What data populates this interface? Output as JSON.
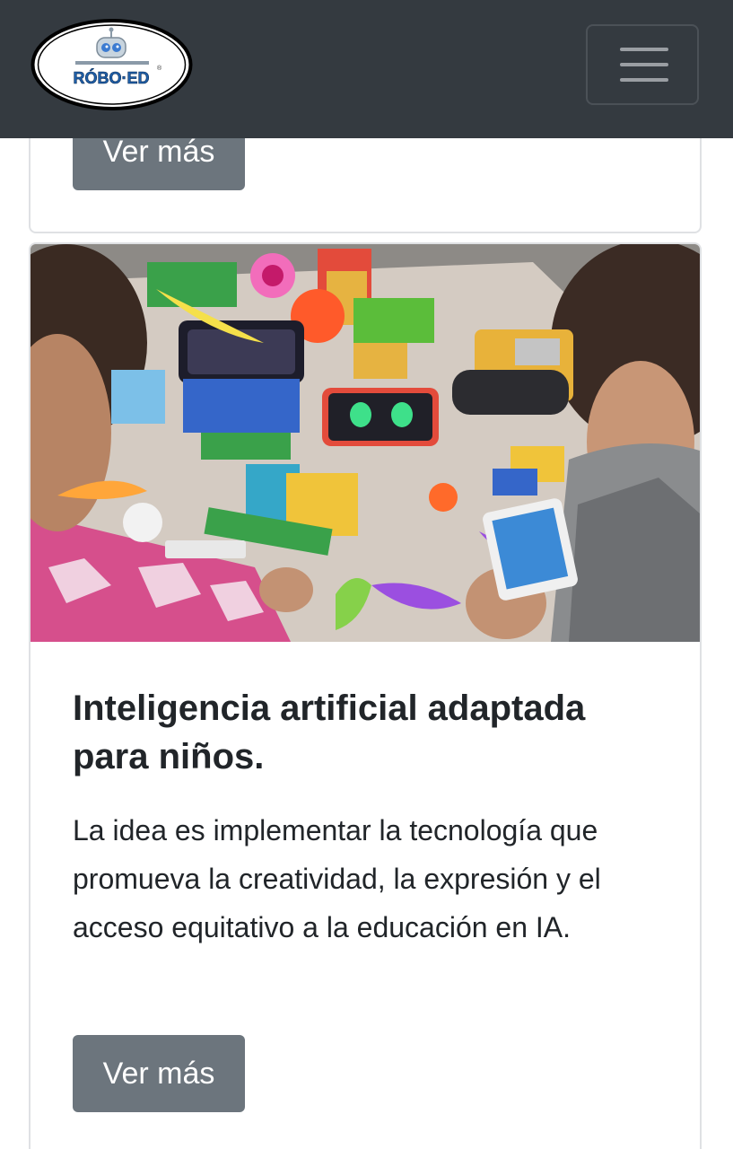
{
  "navbar": {
    "logo_text": "RÓBO·ED",
    "logo_mark": "®",
    "menu_icon": "hamburger-menu-icon"
  },
  "previous_card": {
    "button_label": "Ver más"
  },
  "card": {
    "image_description_icon": "photo-kids-building-lego-robots",
    "title": "Inteligencia artificial adaptada para niños.",
    "text": "La idea es implementar la tecnología que promueva la creatividad, la expresión y el acceso equitativo a la educación en IA.",
    "button_label": "Ver más"
  },
  "colors": {
    "navbar_bg": "#343a40",
    "button_bg": "#6c757d",
    "text": "#212529",
    "card_border": "#dfe1e4"
  }
}
